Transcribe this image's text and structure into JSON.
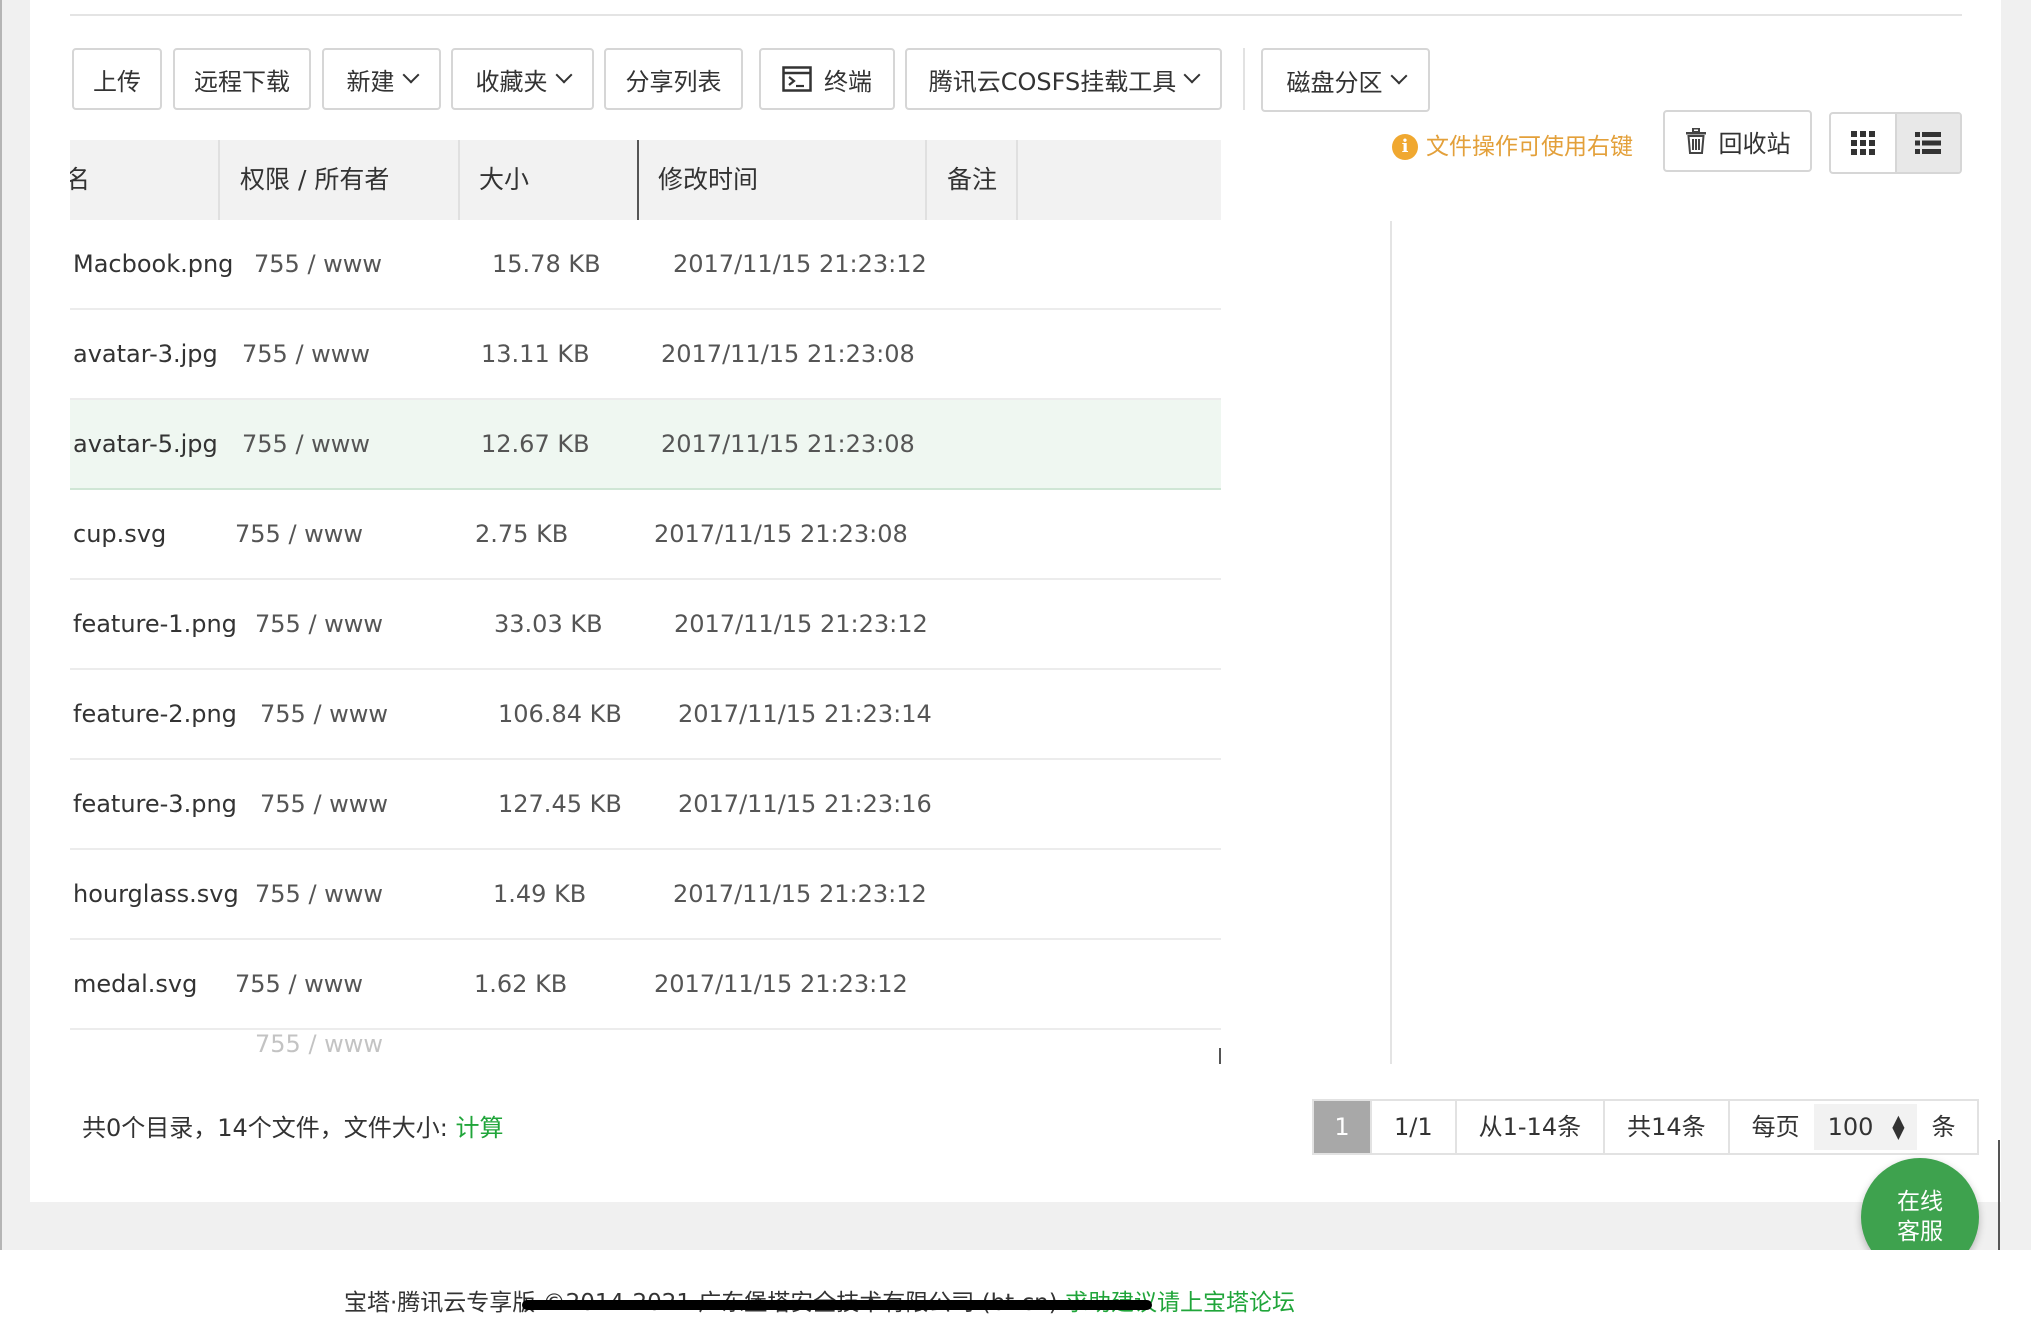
{
  "toolbar": {
    "upload": "上传",
    "remote_download": "远程下载",
    "new": "新建",
    "favorites": "收藏夹",
    "share_list": "分享列表",
    "terminal": "终端",
    "cosfs": "腾讯云COSFS挂载工具",
    "disk_partition": "磁盘分区"
  },
  "tip": "文件操作可使用右键",
  "recycle_bin": "回收站",
  "columns": {
    "name": "名",
    "perm": "权限 / 所有者",
    "size": "大小",
    "mtime": "修改时间",
    "note": "备注"
  },
  "files": [
    {
      "name": "Macbook.png",
      "perm": "755",
      "owner": "www",
      "size": "15.78 KB",
      "mtime": "2017/11/15 21:23:12"
    },
    {
      "name": "avatar-3.jpg",
      "perm": "755",
      "owner": "www",
      "size": "13.11 KB",
      "mtime": "2017/11/15 21:23:08"
    },
    {
      "name": "avatar-5.jpg",
      "perm": "755",
      "owner": "www",
      "size": "12.67 KB",
      "mtime": "2017/11/15 21:23:08",
      "selected": true
    },
    {
      "name": "cup.svg",
      "perm": "755",
      "owner": "www",
      "size": "2.75 KB",
      "mtime": "2017/11/15 21:23:08"
    },
    {
      "name": "feature-1.png",
      "perm": "755",
      "owner": "www",
      "size": "33.03 KB",
      "mtime": "2017/11/15 21:23:12"
    },
    {
      "name": "feature-2.png",
      "perm": "755",
      "owner": "www",
      "size": "106.84 KB",
      "mtime": "2017/11/15 21:23:14"
    },
    {
      "name": "feature-3.png",
      "perm": "755",
      "owner": "www",
      "size": "127.45 KB",
      "mtime": "2017/11/15 21:23:16"
    },
    {
      "name": "hourglass.svg",
      "perm": "755",
      "owner": "www",
      "size": "1.49 KB",
      "mtime": "2017/11/15 21:23:12"
    },
    {
      "name": "medal.svg",
      "perm": "755",
      "owner": "www",
      "size": "1.62 KB",
      "mtime": "2017/11/15 21:23:12"
    },
    {
      "name": "",
      "perm": "755",
      "owner": "www",
      "size": "",
      "mtime": ""
    }
  ],
  "summary": {
    "text": "共0个目录，14个文件，文件大小:",
    "calc": "计算"
  },
  "pager": {
    "current": "1",
    "pages": "1/1",
    "range": "从1-14条",
    "total": "共14条",
    "per_page_label": "每页",
    "per_page_value": "100",
    "unit": "条"
  },
  "chat": {
    "line1": "在线",
    "line2": "客服"
  },
  "footer": {
    "copyright": "宝塔·腾讯云专享版 ©2014-2021 广东堡塔安全技术有限公司 (bt.cn)",
    "link": "求助建议请上宝塔论坛"
  },
  "colors": {
    "accent_green": "#20a53a",
    "tip_orange": "#e3a03a",
    "selected_row": "#eff7f1"
  }
}
